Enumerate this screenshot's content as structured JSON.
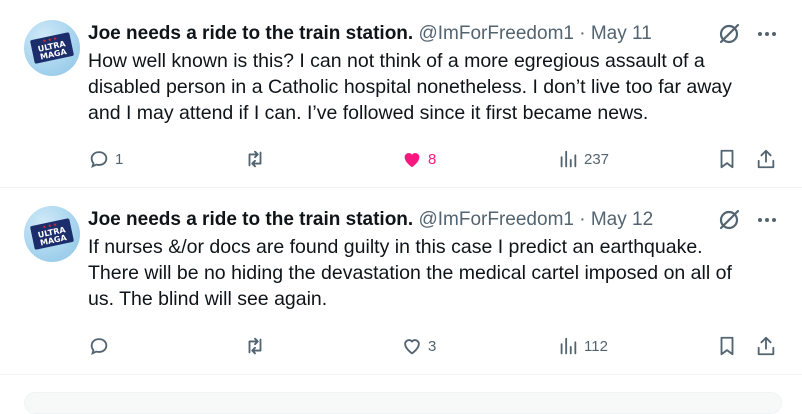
{
  "tweets": [
    {
      "author_name": "Joe needs a ride to the train station.",
      "handle": "@ImForFreedom1",
      "separator": "·",
      "date": "May 11",
      "avatar_text": [
        "ULTRA",
        "MAGA"
      ],
      "lines": [
        "How well known is this?  I can not think of a more egregious assault of a",
        "disabled person in a Catholic hospital nonetheless. I don’t live too far away",
        "and I may attend if I can. I’ve followed since it first became news."
      ],
      "replies": "1",
      "reposts": "",
      "likes": "8",
      "liked": true,
      "views": "237"
    },
    {
      "author_name": "Joe needs a ride to the train station.",
      "handle": "@ImForFreedom1",
      "separator": "·",
      "date": "May 12",
      "avatar_text": [
        "ULTRA",
        "MAGA"
      ],
      "lines": [
        "If nurses &/or docs are found guilty in this case I predict an earthquake.",
        "There will be no hiding the devastation the medical cartel imposed on all of",
        "us. The blind will see again."
      ],
      "replies": "",
      "reposts": "",
      "likes": "3",
      "liked": false,
      "views": "112"
    }
  ],
  "icons": {
    "reply": "reply-icon",
    "repost": "repost-icon",
    "like": "heart-icon",
    "views": "views-icon",
    "bookmark": "bookmark-icon",
    "share": "share-icon",
    "grok": "grok-icon",
    "more": "more-icon"
  },
  "colors": {
    "text": "#0f1419",
    "secondary": "#536471",
    "like": "#f91880",
    "border": "#eff3f4"
  }
}
